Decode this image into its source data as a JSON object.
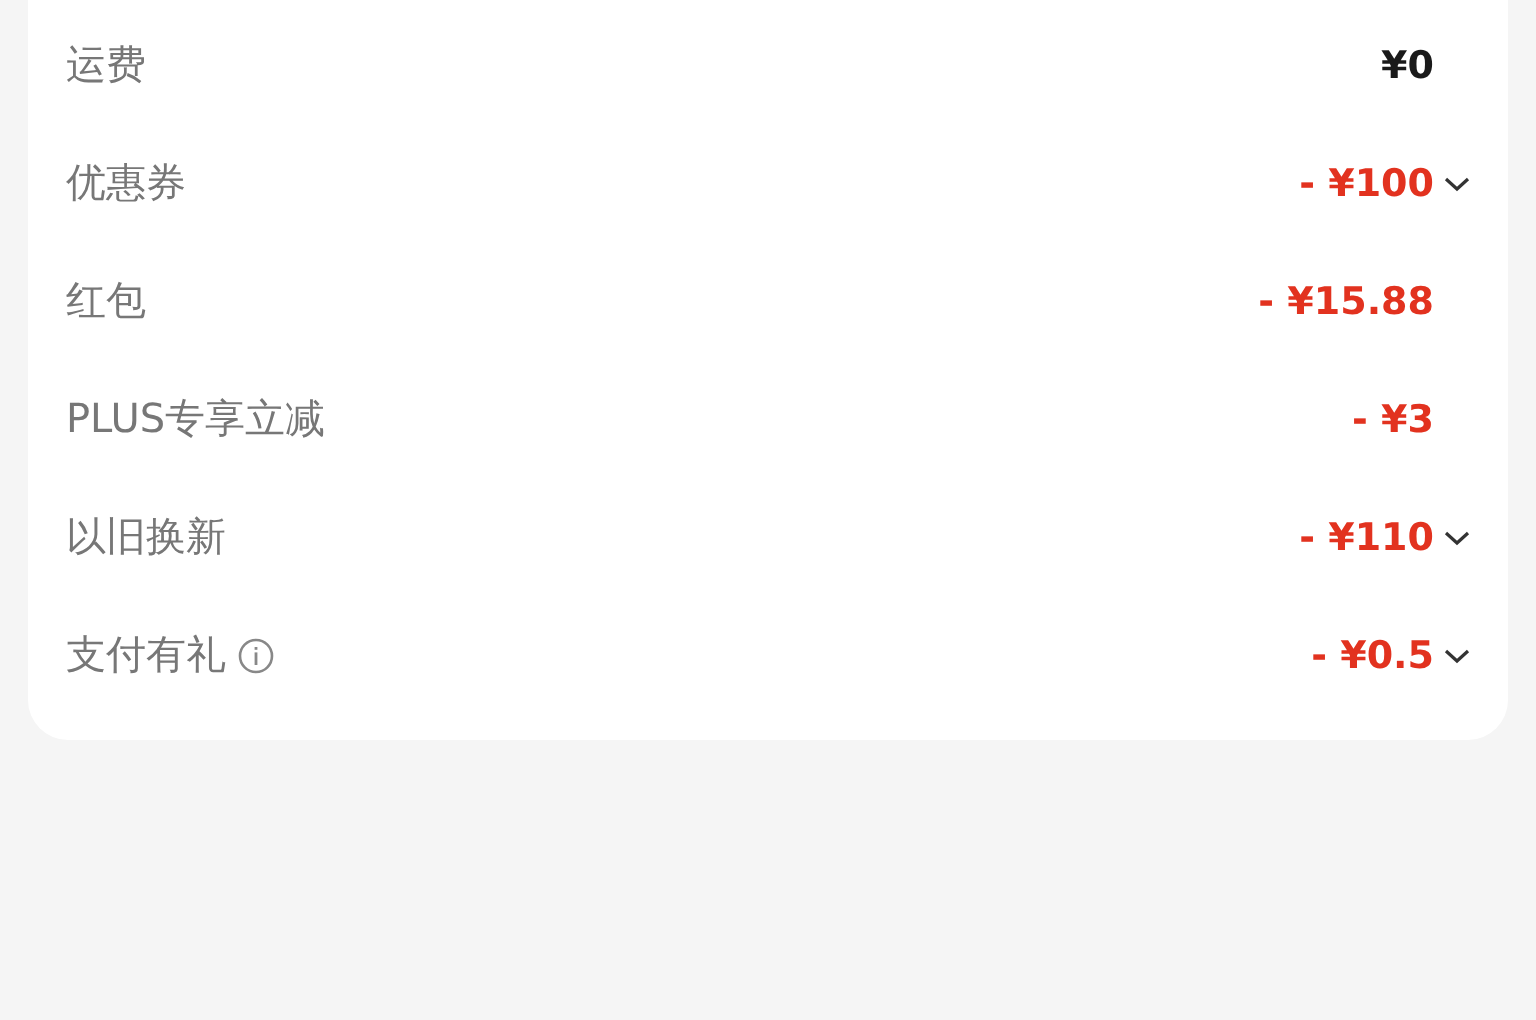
{
  "fee_rows": [
    {
      "label": "运费",
      "value": "¥0",
      "kind": "plain",
      "expandable": false,
      "info": false
    },
    {
      "label": "优惠券",
      "value": "- ¥100",
      "kind": "discount",
      "expandable": true,
      "info": false
    },
    {
      "label": "红包",
      "value": "- ¥15.88",
      "kind": "discount",
      "expandable": false,
      "info": false
    },
    {
      "label": "PLUS专享立减",
      "value": "- ¥3",
      "kind": "discount",
      "expandable": false,
      "info": false
    },
    {
      "label": "以旧换新",
      "value": "- ¥110",
      "kind": "discount",
      "expandable": true,
      "info": false
    },
    {
      "label": "支付有礼",
      "value": "- ¥0.5",
      "kind": "discount",
      "expandable": true,
      "info": true
    }
  ]
}
